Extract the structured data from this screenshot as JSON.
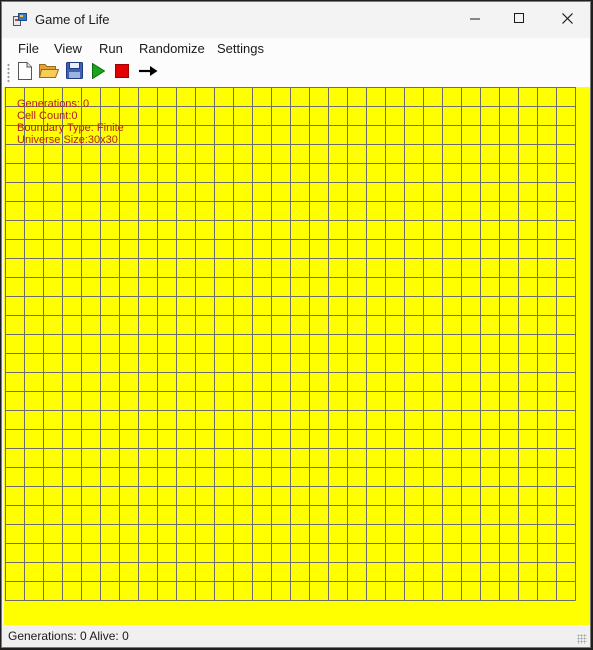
{
  "window": {
    "title": "Game of Life",
    "controls": {
      "minimize_icon": "minimize-icon",
      "maximize_icon": "maximize-icon",
      "close_icon": "close-icon"
    }
  },
  "menu": [
    {
      "label": "File"
    },
    {
      "label": "View"
    },
    {
      "label": "Run"
    },
    {
      "label": "Randomize"
    },
    {
      "label": "Settings"
    }
  ],
  "toolbar": [
    {
      "name": "new-button",
      "icon": "new-file-icon"
    },
    {
      "name": "open-button",
      "icon": "open-folder-icon"
    },
    {
      "name": "save-button",
      "icon": "save-icon"
    },
    {
      "name": "start-button",
      "icon": "play-icon"
    },
    {
      "name": "stop-button",
      "icon": "stop-icon"
    },
    {
      "name": "next-button",
      "icon": "arrow-right-icon"
    }
  ],
  "universe": {
    "background_color": "#ffff00",
    "grid_color": "#6d6d6d",
    "columns": 30,
    "rows": 30,
    "visible_columns": 30,
    "visible_rows": 27,
    "hud": {
      "generations": "Generations: 0",
      "cell_count": "Cell Count:0",
      "boundary": "Boundary Type: Finite",
      "size": "Universe Size:30x30"
    },
    "hud_color": "#b22222"
  },
  "status": {
    "text": "Generations: 0 Alive: 0"
  }
}
